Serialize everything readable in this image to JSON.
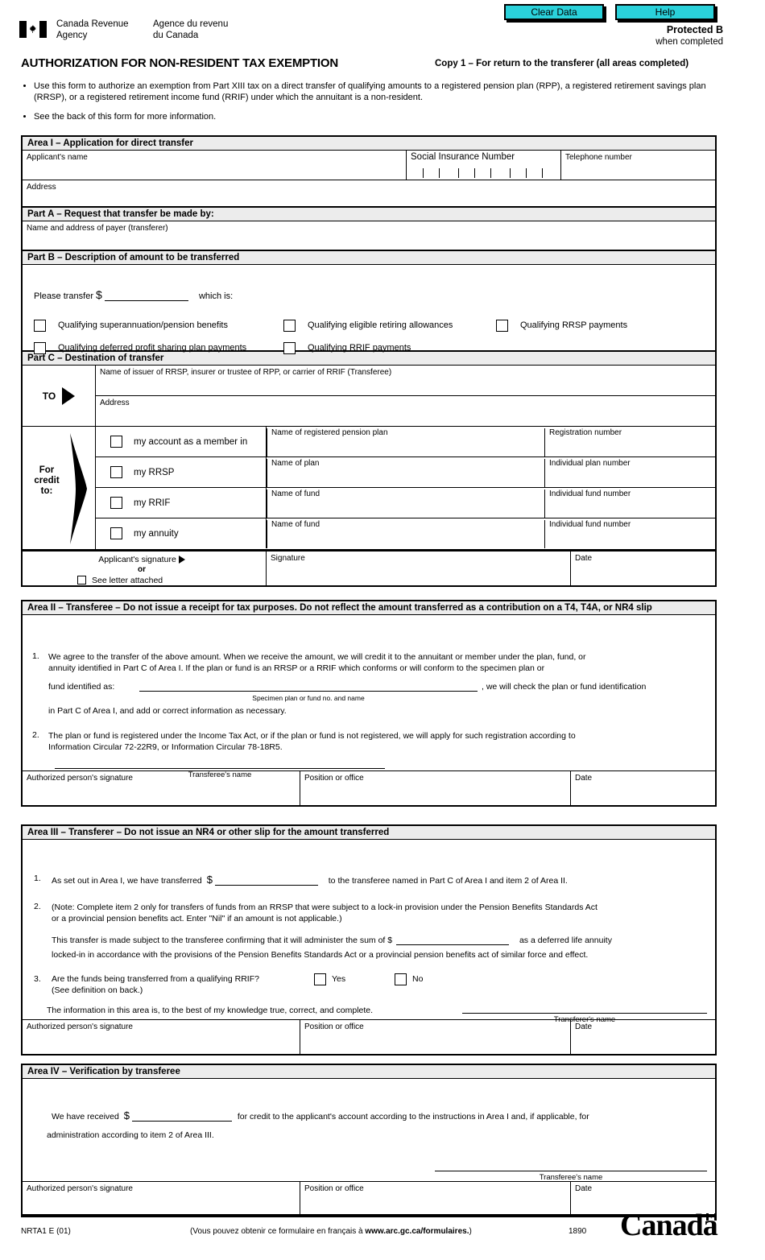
{
  "header": {
    "clear_data_button": "Clear Data",
    "help_button": "Help",
    "protected": "Protected B",
    "protected_sub": "when completed",
    "agency_en": "Canada Revenue\nAgency",
    "agency_en_l1": "Canada Revenue",
    "agency_en_l2": "Agency",
    "agency_fr_l1": "Agence du revenu",
    "agency_fr_l2": "du Canada",
    "title": "AUTHORIZATION FOR NON-RESIDENT TAX EXEMPTION",
    "copy_line": "Copy 1 – For return to the transferer (all areas completed)",
    "bullets": [
      "Use this form to authorize an exemption from Part XIII tax on a direct transfer of qualifying amounts to a registered pension plan (RPP), a registered retirement savings plan (RRSP), or a registered retirement income fund (RRIF) under which the annuitant is a non-resident.",
      "See the back of this form for more information."
    ],
    "accent_color": "#2ad1da"
  },
  "area1": {
    "heading": "Area I – Application for direct transfer",
    "applicant_name_label": "Applicant's name",
    "sin_label": "Social Insurance Number",
    "telephone_label": "Telephone number",
    "address_label": "Address",
    "partA": {
      "heading": "Part A – Request that transfer be made by:",
      "payer_label": "Name and address of payer (transferer)"
    },
    "partB": {
      "heading": "Part B – Description of amount to be transferred",
      "please_transfer": "Please transfer",
      "dollar": "$",
      "which_is": "which is:",
      "checkboxes": [
        "Qualifying superannuation/pension benefits",
        "Qualifying eligible retiring allowances",
        "Qualifying RRSP payments",
        "Qualifying deferred profit sharing plan payments",
        "Qualifying RRIF payments"
      ]
    },
    "partC": {
      "heading": "Part C – Destination of transfer",
      "to_label": "TO",
      "issuer_label": "Name of issuer of RRSP, insurer or trustee of RPP, or carrier of RRIF (Transferee)",
      "address_label": "Address",
      "for_credit_to": "For\ncredit\nto:",
      "for_credit_l1": "For",
      "for_credit_l2": "credit",
      "for_credit_l3": "to:",
      "rows": [
        {
          "option": "my account as a member in",
          "mid_label": "Name of registered pension plan",
          "right_label": "Registration number"
        },
        {
          "option": "my RRSP",
          "mid_label": "Name of plan",
          "right_label": "Individual plan number"
        },
        {
          "option": "my RRIF",
          "mid_label": "Name of fund",
          "right_label": "Individual fund number"
        },
        {
          "option": "my annuity",
          "mid_label": "Name of fund",
          "right_label": "Individual fund number"
        }
      ],
      "signature_block": {
        "applicants_signature": "Applicant's signature",
        "or": "or",
        "see_letter": "See letter attached",
        "signature_label": "Signature",
        "date_label": "Date"
      }
    }
  },
  "area2": {
    "heading": "Area II – Transferee – Do not issue a receipt for tax purposes. Do not reflect the amount transferred as a contribution on a T4, T4A, or NR4 slip",
    "item1_num": "1.",
    "item1_a": "We agree to the transfer of the above amount. When we receive the amount, we will credit it to the annuitant or member under the plan, fund, or",
    "item1_b": "annuity identified in Part C of Area I. If the plan or fund is an RRSP or a RRIF which conforms or will conform to the specimen plan or",
    "fund_identified_as": "fund identified as:",
    "specimen_caption": "Specimen plan or fund no. and name",
    "item1_c": ", we will check the plan or fund identification",
    "item1_d": "in Part C of Area I, and add or correct information as necessary.",
    "item2_num": "2.",
    "item2_a": "The plan or fund is registered under the Income Tax Act, or if the plan or fund is not registered, we will apply for such registration according to",
    "item2_b": "Information Circular 72-22R9, or Information Circular 78-18R5.",
    "transferee_name_caption": "Transferee's name",
    "auth_signature_label": "Authorized person's signature",
    "position_label": "Position or office",
    "date_label": "Date"
  },
  "area3": {
    "heading": "Area III – Transferer – Do not issue an NR4 or other slip for the amount transferred",
    "item1_num": "1.",
    "item1_a": "As set out in Area I, we have transferred",
    "dollar": "$",
    "item1_b": "to the transferee named in Part C of Area I and item 2 of Area II.",
    "item2_num": "2.",
    "item2_a": "(Note: Complete item 2 only for transfers of funds from an RRSP that were subject to a lock-in provision under the Pension Benefits Standards Act",
    "item2_b": "or a provincial pension benefits act. Enter \"Nil\" if an amount is not applicable.)",
    "item2_c": "This transfer is made subject to the transferee confirming that it will administer the sum of $",
    "item2_d": "as a deferred life annuity",
    "item2_e": "locked-in in accordance with the provisions of the Pension Benefits Standards Act or a provincial pension benefits act of similar force and effect.",
    "item3_num": "3.",
    "item3_a": "Are the funds being transferred from a qualifying RRIF?",
    "item3_b": "(See definition on back.)",
    "yes_label": "Yes",
    "no_label": "No",
    "declaration": "The information in this area is, to the best of my knowledge true, correct, and complete.",
    "transferer_name_caption": "Transferer's name",
    "auth_signature_label": "Authorized person's signature",
    "position_label": "Position or office",
    "date_label": "Date"
  },
  "area4": {
    "heading": "Area IV – Verification by transferee",
    "line1_a": "We have received",
    "dollar": "$",
    "line1_b": "for credit to the applicant's account according to the instructions in Area I and, if applicable, for",
    "line2": "administration according to item 2 of Area III.",
    "transferee_name_caption": "Transferee's name",
    "auth_signature_label": "Authorized person's signature",
    "position_label": "Position or office",
    "date_label": "Date"
  },
  "footer": {
    "form_code": "NRTA1 E (01)",
    "french_note_a": "(Vous pouvez obtenir ce formulaire en français à ",
    "french_note_b": "www.arc.gc.ca/formulaires.",
    "french_note_c": ")",
    "number": "1890",
    "wordmark": "Canada"
  }
}
